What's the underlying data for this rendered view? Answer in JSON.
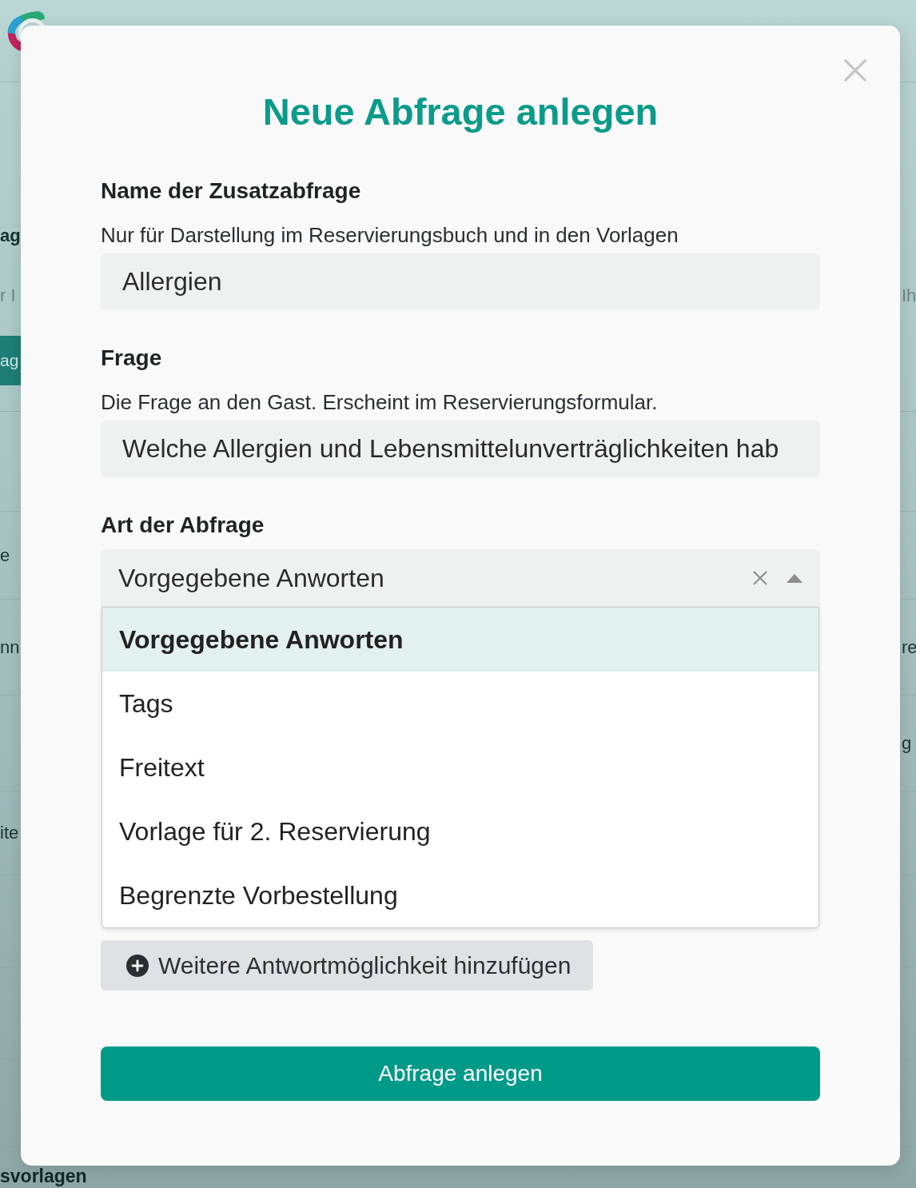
{
  "page_behind": {
    "heading_fragment": "ag",
    "subtitle_fragments": {
      "left": "r I",
      "right": "Ih"
    },
    "button_fragment": "ag",
    "row_fragments": [
      {
        "left": "e"
      },
      {
        "left": "nn",
        "right": "re"
      },
      {
        "right": "g"
      },
      {
        "left": "ite"
      }
    ],
    "section_heading_fragment": "svorlagen"
  },
  "dialog": {
    "title": "Neue Abfrage anlegen",
    "fields": [
      {
        "kind": "text",
        "label": "Name der Zusatzabfrage",
        "description": "Nur für Darstellung im Reservierungsbuch und in den Vorlagen",
        "value": "Allergien"
      },
      {
        "kind": "text",
        "label": "Frage",
        "description": "Die Frage an den Gast. Erscheint im Reservierungsformular.",
        "value": "Welche Allergien und Lebensmittelunverträglichkeiten hab"
      },
      {
        "kind": "select",
        "label": "Art der Abfrage",
        "value": "Vorgegebene Anworten",
        "expanded": true,
        "options": [
          {
            "label": "Vorgegebene Anworten",
            "selected": true
          },
          {
            "label": "Tags",
            "selected": false
          },
          {
            "label": "Freitext",
            "selected": false
          },
          {
            "label": "Vorlage für 2. Reservierung",
            "selected": false
          },
          {
            "label": "Begrenzte Vorbestellung",
            "selected": false
          }
        ]
      }
    ],
    "add_answer_button": "Weitere Antwortmöglichkeit hinzufügen",
    "submit_button": "Abfrage anlegen"
  }
}
